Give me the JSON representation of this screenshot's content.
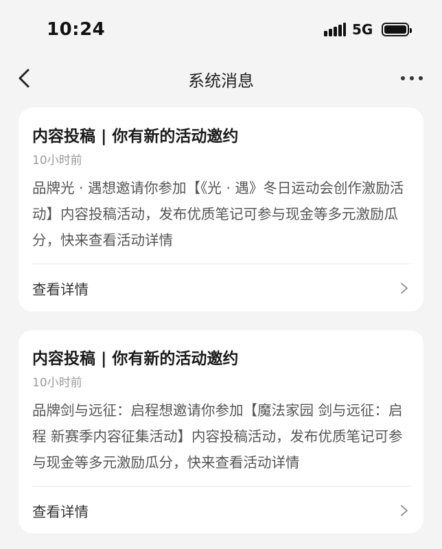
{
  "status_bar": {
    "time": "10:24",
    "network": "5G",
    "icons": [
      "signal-icon",
      "battery-icon"
    ]
  },
  "nav": {
    "title": "系统消息",
    "back_icon": "chevron-left-icon",
    "more_icon": "more-dots-icon"
  },
  "messages": [
    {
      "title": "内容投稿 | 你有新的活动邀约",
      "time": "10小时前",
      "body": "品牌光 · 遇想邀请你参加【《光 · 遇》冬日运动会创作激励活动】内容投稿活动，发布优质笔记可参与现金等多元激励瓜分，快来查看活动详情",
      "action_label": "查看详情"
    },
    {
      "title": "内容投稿 | 你有新的活动邀约",
      "time": "10小时前",
      "body": "品牌剑与远征：启程想邀请你参加【魔法家园 剑与远征：启程 新赛季内容征集活动】内容投稿活动，发布优质笔记可参与现金等多元激励瓜分，快来查看活动详情",
      "action_label": "查看详情"
    }
  ],
  "colors": {
    "background": "#f4f4f4",
    "card": "#ffffff",
    "title_text": "#1a1a1a",
    "body_text": "#555555",
    "time_text": "#9a9a9a"
  }
}
